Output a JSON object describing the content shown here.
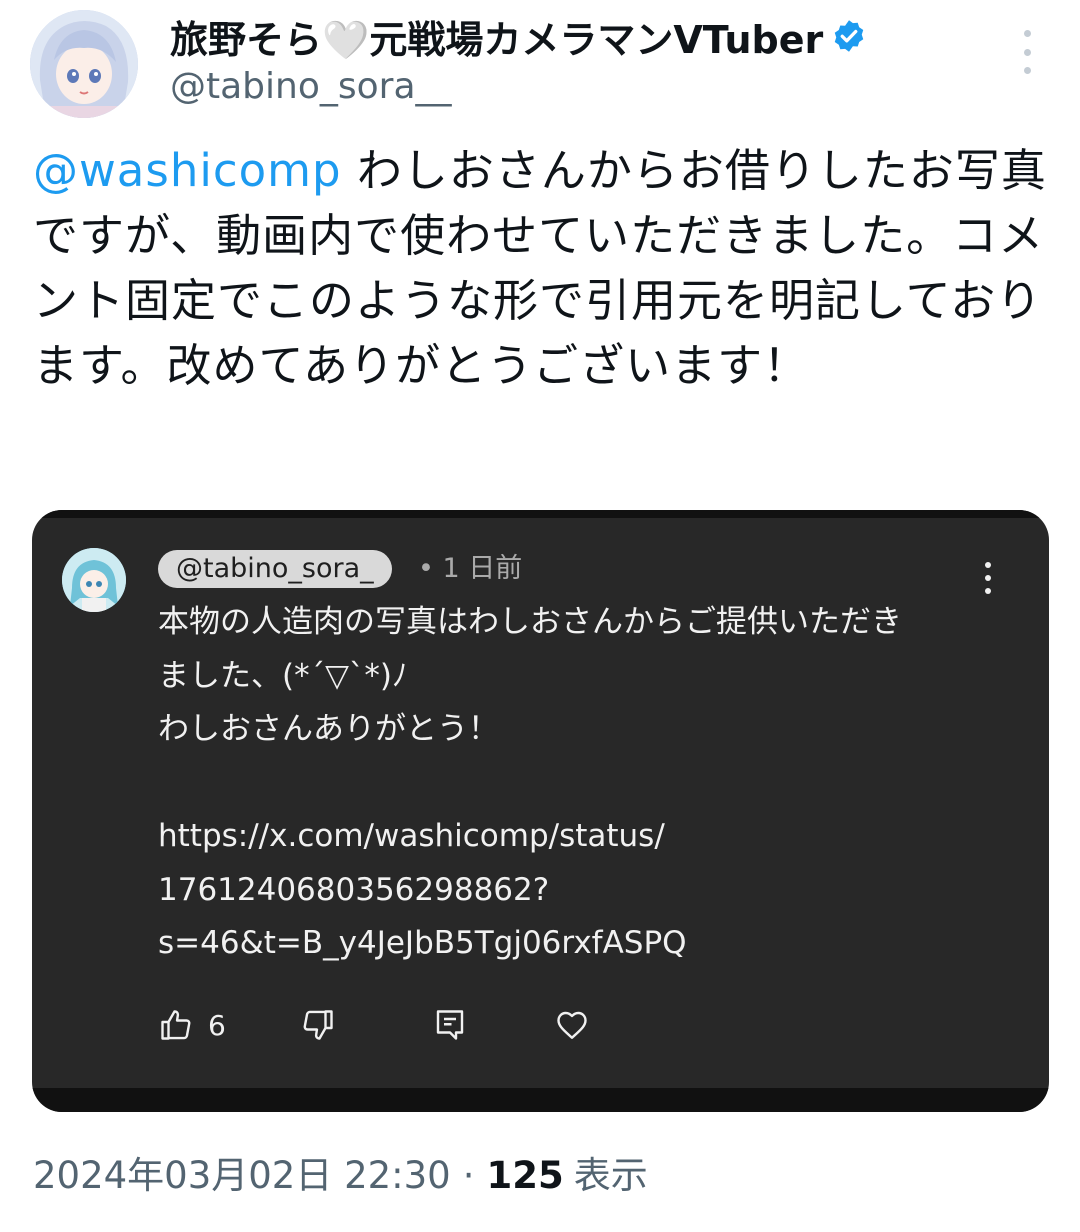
{
  "author": {
    "display_name": "旅野そら🤍元戦場カメラマンVTuber",
    "handle": "@tabino_sora__",
    "verified": true,
    "avatar_icon": "anime-avatar-image"
  },
  "tweet": {
    "mention": "@washicomp",
    "text": " わしおさんからお借りしたお写真ですが、動画内で使わせていただきました。コメント固定でこのような形で引用元を明記しております。改めてありがとうございます！"
  },
  "embedded_comment": {
    "handle": "@tabino_sora_",
    "time": "• 1 日前",
    "lines": [
      "本物の人造肉の写真はわしおさんからご提供いただき",
      "ました、(*´▽`*)ﾉ",
      "わしおさんありがとう！",
      "",
      "https://x.com/washicomp/status/",
      "1761240680356298862?",
      "s=46&t=B_y4JeJbB5Tgj06rxfASPQ"
    ],
    "like_count": "6",
    "icons": [
      "thumbs-up-icon",
      "thumbs-down-icon",
      "reply-icon",
      "heart-icon"
    ]
  },
  "meta": {
    "timestamp": "2024年03月02日 22:30",
    "separator": "·",
    "views_count": "125",
    "views_label": "表示"
  },
  "colors": {
    "accent": "#1d9bf0",
    "card_bg": "#282828",
    "secondary_text": "#536471"
  }
}
